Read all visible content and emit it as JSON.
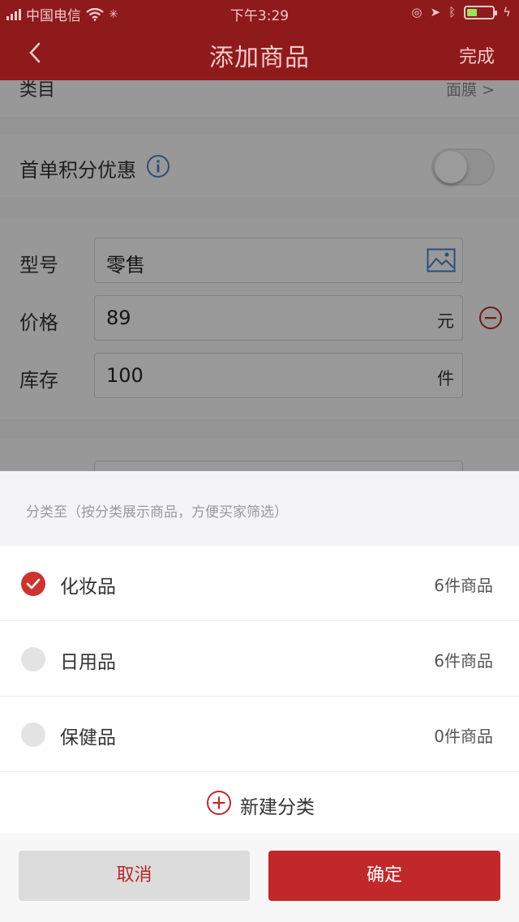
{
  "status_bar": {
    "carrier": "中国电信",
    "time": "下午3:29"
  },
  "nav": {
    "title": "添加商品",
    "done": "完成"
  },
  "form": {
    "category_label": "类目",
    "category_value": "面膜 >",
    "points_label": "首单积分优惠",
    "points_toggle_on": false,
    "model_label": "型号",
    "model_value": "零售",
    "price_label": "价格",
    "price_value": "89",
    "price_unit": "元",
    "stock_label": "库存",
    "stock_value": "100",
    "stock_unit": "件"
  },
  "sheet": {
    "hint": "分类至（按分类展示商品，方便买家筛选）",
    "options": [
      {
        "name": "化妆品",
        "count": "6件商品",
        "checked": true
      },
      {
        "name": "日用品",
        "count": "6件商品",
        "checked": false
      },
      {
        "name": "保健品",
        "count": "0件商品",
        "checked": false
      }
    ],
    "new_category": "新建分类",
    "cancel": "取消",
    "confirm": "确定"
  },
  "colors": {
    "brand_red": "#8e1a1c",
    "button_red": "#c0282c",
    "check_red": "#cc3430"
  }
}
